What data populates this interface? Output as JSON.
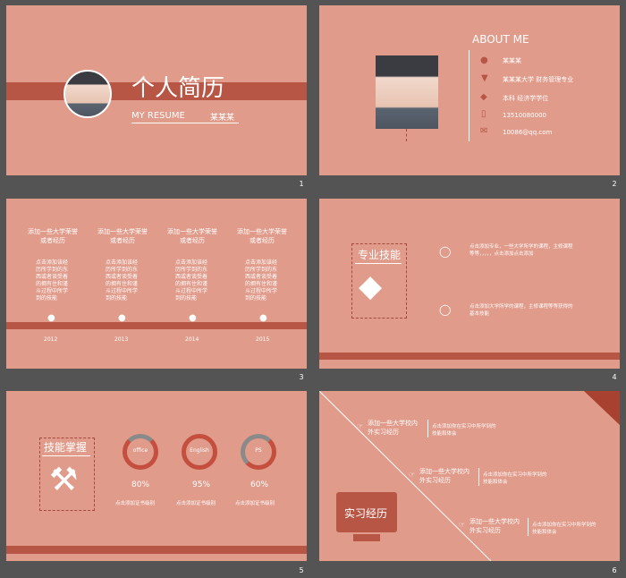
{
  "colors": {
    "bg": "#e09b8b",
    "accent": "#b85646",
    "dark_gap": "#545454"
  },
  "slides": [
    {
      "number": "1",
      "title": "个人简历",
      "subtitle": "MY RESUME",
      "name": "某某某"
    },
    {
      "number": "2",
      "title": "ABOUT ME",
      "items": [
        {
          "icon": "person-icon",
          "text": "某某某"
        },
        {
          "icon": "location-icon",
          "text": "某某某大学 财务管理专业"
        },
        {
          "icon": "graduation-icon",
          "text": "本科    经济学学位"
        },
        {
          "icon": "phone-icon",
          "text": "13510080000"
        },
        {
          "icon": "mail-icon",
          "text": "10086@qq.com"
        }
      ]
    },
    {
      "number": "3",
      "columns": [
        {
          "title": "添加一些大学荣誉或者经历",
          "body": "点击添加该经历所学到的东西或者谈受着的拥有住和谨斗过程中所学到的技能",
          "year": "2012"
        },
        {
          "title": "添加一些大学荣誉或者经历",
          "body": "点击添加该经历所学到的东西或者谈受着的拥有住和谨斗过程中所学到的技能",
          "year": "2013"
        },
        {
          "title": "添加一些大学荣誉或者经历",
          "body": "点击添加该经历所学到的东西或者谈受着的拥有住和谨斗过程中所学到的技能",
          "year": "2014"
        },
        {
          "title": "添加一些大学荣誉或者经历",
          "body": "点击添加该经历所学到的东西或者谈受着的拥有住和谨斗过程中所学到的技能",
          "year": "2015"
        }
      ]
    },
    {
      "number": "4",
      "title": "专业技能",
      "points": [
        "点击添加专业，一些大学所学的课程，主修课程等等，，，，，点击添加点击添加",
        "点击添加大学所学的课程，主修课程等等获得的基本技能"
      ]
    },
    {
      "number": "5",
      "title": "技能掌握",
      "skills": [
        {
          "name": "office",
          "percent": "80%",
          "progress": 0.8
        },
        {
          "name": "English",
          "percent": "95%",
          "progress": 0.95
        },
        {
          "name": "PS",
          "percent": "60%",
          "progress": 0.6
        }
      ],
      "caption": "点击添加证书级别"
    },
    {
      "number": "6",
      "title": "实习经历",
      "entries": [
        {
          "title": "添加一些大学校内外实习经历",
          "desc": "点击添加你在实习中所学到的技能和体会"
        },
        {
          "title": "添加一些大学校内外实习经历",
          "desc": "点击添加你在实习中所学到的技能和体会"
        },
        {
          "title": "添加一些大学校内外实习经历",
          "desc": "点击添加你在实习中所学到的技能和体会"
        }
      ]
    }
  ]
}
